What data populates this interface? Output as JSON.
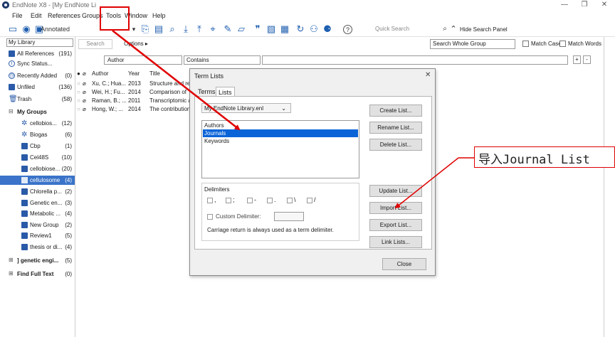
{
  "window": {
    "title": "EndNote X8 - [My EndNote Li",
    "controls": [
      "—",
      "❐",
      "✕"
    ]
  },
  "menu": [
    "File",
    "Edit",
    "References",
    "Groups",
    "Tools",
    "Window",
    "Help"
  ],
  "toolbar": {
    "annotated_label": "Annotated",
    "quick_search_placeholder": "Quick Search",
    "hide_search_panel": "Hide Search Panel"
  },
  "left_panel": {
    "library_select": "My Library",
    "items": [
      {
        "label": "All References",
        "count": "(191)"
      },
      {
        "label": "Sync Status...",
        "count": ""
      },
      {
        "label": "Recently Added",
        "count": "(0)"
      },
      {
        "label": "Unfiled",
        "count": "(136)"
      },
      {
        "label": "Trash",
        "count": "(58)"
      }
    ],
    "my_groups_label": "My Groups",
    "groups": [
      {
        "label": "cellobios...",
        "count": "(12)"
      },
      {
        "label": "Biogas",
        "count": "(6)"
      },
      {
        "label": "Cbp",
        "count": "(1)"
      },
      {
        "label": "Cel48S",
        "count": "(10)"
      },
      {
        "label": "cellobiose...",
        "count": "(20)"
      },
      {
        "label": "cellulosome",
        "count": "(4)"
      },
      {
        "label": "Chlorella p...",
        "count": "(2)"
      },
      {
        "label": "Genetic en...",
        "count": "(3)"
      },
      {
        "label": "Metabolic ...",
        "count": "(4)"
      },
      {
        "label": "New Group",
        "count": "(2)"
      },
      {
        "label": "Review1",
        "count": "(5)"
      },
      {
        "label": "thesis or di...",
        "count": "(4)"
      }
    ],
    "genetic_engi": {
      "label": "] genetic engi...",
      "count": "(5)"
    },
    "find_full_text": {
      "label": "Find Full Text",
      "count": "(0)"
    }
  },
  "search": {
    "search_button": "Search",
    "options_button": "Options ▸",
    "scope": "Search Whole Group",
    "match_case": "Match Case",
    "match_words": "Match Words",
    "field": "Author",
    "operator": "Contains"
  },
  "references": {
    "headers": [
      "Author",
      "Year",
      "Title"
    ],
    "rows": [
      {
        "author": "Xu, C.; Hua...",
        "year": "2013",
        "title": "Structure and reg"
      },
      {
        "author": "Wei, H.; Fu...",
        "year": "2014",
        "title": "Comparison of"
      },
      {
        "author": "Raman, B.; ...",
        "year": "2011",
        "title": "Transcriptomic a"
      },
      {
        "author": "Hong, W.; ...",
        "year": "2014",
        "title": "The contribution"
      }
    ]
  },
  "dialog": {
    "title": "Term Lists",
    "tabs": [
      "Terms",
      "Lists"
    ],
    "library_dropdown": "My EndNote Library.enl",
    "lists": [
      "Authors",
      "Journals",
      "Keywords"
    ],
    "selected_list": "Journals",
    "delimiters_label": "Delimiters",
    "delimiter_symbols": [
      ",",
      ";",
      "-",
      ".",
      "\\",
      "/"
    ],
    "custom_delimiter_label": "Custom Delimiter:",
    "carriage_note": "Carriage return is always used as a term delimiter.",
    "buttons": [
      "Create List...",
      "Rename List...",
      "Delete List...",
      "Update List...",
      "Import List...",
      "Export List...",
      "Link Lists..."
    ],
    "close_button": "Close"
  },
  "annotation": {
    "callout_text": "导入Journal List",
    "color": "#e00000"
  },
  "colors": {
    "accent": "#2a5aa8",
    "selection": "#3a73c9",
    "list_selection": "#0a64d8"
  }
}
